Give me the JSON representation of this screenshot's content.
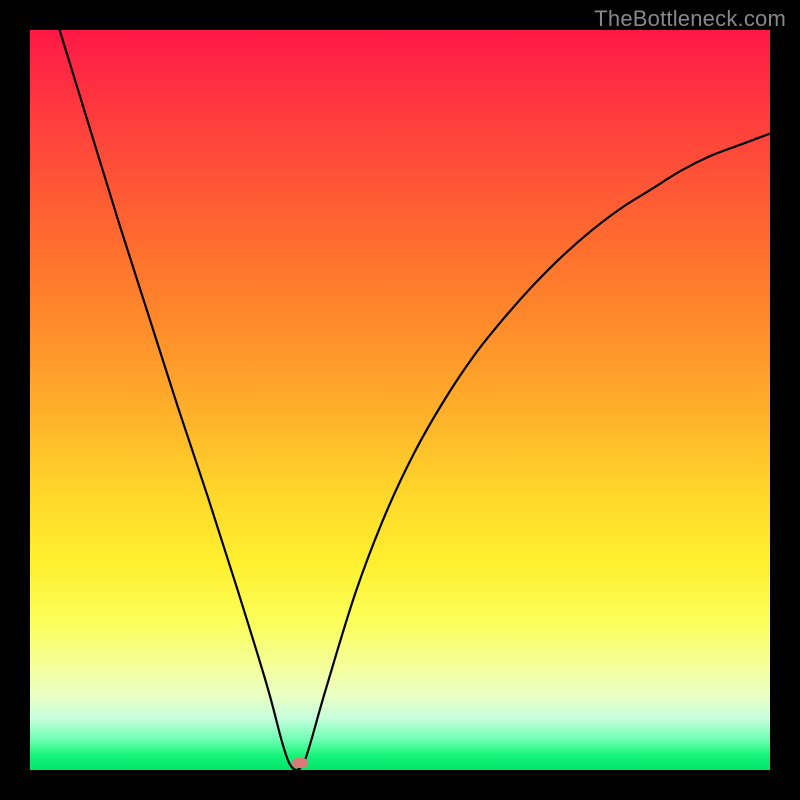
{
  "watermark": "TheBottleneck.com",
  "chart_data": {
    "type": "line",
    "title": "",
    "xlabel": "",
    "ylabel": "",
    "x_range": [
      0,
      100
    ],
    "y_range": [
      0,
      100
    ],
    "minimum_at_x_pct": 36,
    "marker": {
      "x_pct": 36.5,
      "y_pct": 99
    },
    "curve_points": [
      {
        "x": 4.0,
        "y": 100.0
      },
      {
        "x": 8.0,
        "y": 87.0
      },
      {
        "x": 12.0,
        "y": 74.0
      },
      {
        "x": 16.0,
        "y": 61.5
      },
      {
        "x": 20.0,
        "y": 49.0
      },
      {
        "x": 24.0,
        "y": 37.0
      },
      {
        "x": 28.0,
        "y": 24.5
      },
      {
        "x": 32.0,
        "y": 11.5
      },
      {
        "x": 34.0,
        "y": 4.0
      },
      {
        "x": 35.0,
        "y": 1.0
      },
      {
        "x": 36.0,
        "y": 0.0
      },
      {
        "x": 37.0,
        "y": 1.0
      },
      {
        "x": 38.0,
        "y": 4.0
      },
      {
        "x": 40.0,
        "y": 11.0
      },
      {
        "x": 44.0,
        "y": 24.0
      },
      {
        "x": 48.0,
        "y": 34.5
      },
      {
        "x": 52.0,
        "y": 43.0
      },
      {
        "x": 56.0,
        "y": 50.0
      },
      {
        "x": 60.0,
        "y": 56.0
      },
      {
        "x": 64.0,
        "y": 61.0
      },
      {
        "x": 68.0,
        "y": 65.5
      },
      {
        "x": 72.0,
        "y": 69.5
      },
      {
        "x": 76.0,
        "y": 73.0
      },
      {
        "x": 80.0,
        "y": 76.0
      },
      {
        "x": 84.0,
        "y": 78.5
      },
      {
        "x": 88.0,
        "y": 81.0
      },
      {
        "x": 92.0,
        "y": 83.0
      },
      {
        "x": 96.0,
        "y": 84.5
      },
      {
        "x": 100.0,
        "y": 86.0
      }
    ],
    "background_gradient": {
      "top": "#ff1846",
      "mid": "#ffd52a",
      "bottom": "#00e56b"
    }
  }
}
